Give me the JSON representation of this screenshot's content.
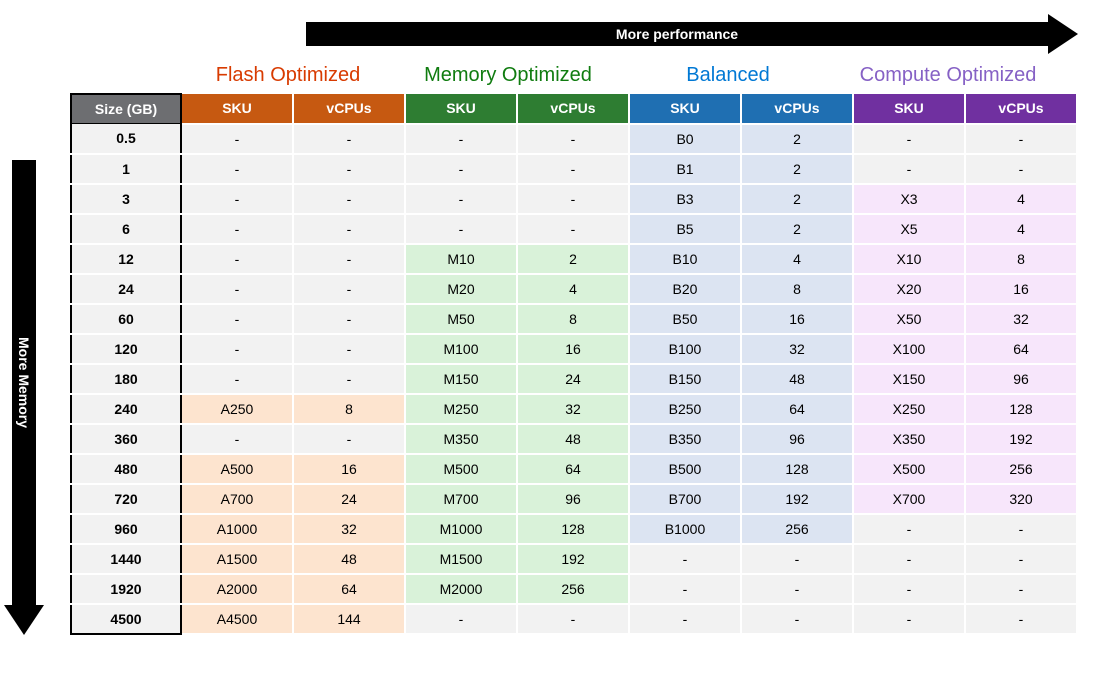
{
  "arrows": {
    "top": "More performance",
    "left": "More Memory"
  },
  "tiers": [
    {
      "key": "flash",
      "label": "Flash Optimized"
    },
    {
      "key": "memory",
      "label": "Memory Optimized"
    },
    {
      "key": "balanced",
      "label": "Balanced"
    },
    {
      "key": "compute",
      "label": "Compute Optimized"
    }
  ],
  "columns": {
    "size": "Size (GB)",
    "sku": "SKU",
    "vcpu": "vCPUs"
  },
  "dash": "-",
  "rows": [
    {
      "size": "0.5",
      "flash": {
        "sku": null,
        "vcpu": null
      },
      "memory": {
        "sku": null,
        "vcpu": null
      },
      "balanced": {
        "sku": "B0",
        "vcpu": "2"
      },
      "compute": {
        "sku": null,
        "vcpu": null
      }
    },
    {
      "size": "1",
      "flash": {
        "sku": null,
        "vcpu": null
      },
      "memory": {
        "sku": null,
        "vcpu": null
      },
      "balanced": {
        "sku": "B1",
        "vcpu": "2"
      },
      "compute": {
        "sku": null,
        "vcpu": null
      }
    },
    {
      "size": "3",
      "flash": {
        "sku": null,
        "vcpu": null
      },
      "memory": {
        "sku": null,
        "vcpu": null
      },
      "balanced": {
        "sku": "B3",
        "vcpu": "2"
      },
      "compute": {
        "sku": "X3",
        "vcpu": "4"
      }
    },
    {
      "size": "6",
      "flash": {
        "sku": null,
        "vcpu": null
      },
      "memory": {
        "sku": null,
        "vcpu": null
      },
      "balanced": {
        "sku": "B5",
        "vcpu": "2"
      },
      "compute": {
        "sku": "X5",
        "vcpu": "4"
      }
    },
    {
      "size": "12",
      "flash": {
        "sku": null,
        "vcpu": null
      },
      "memory": {
        "sku": "M10",
        "vcpu": "2"
      },
      "balanced": {
        "sku": "B10",
        "vcpu": "4"
      },
      "compute": {
        "sku": "X10",
        "vcpu": "8"
      }
    },
    {
      "size": "24",
      "flash": {
        "sku": null,
        "vcpu": null
      },
      "memory": {
        "sku": "M20",
        "vcpu": "4"
      },
      "balanced": {
        "sku": "B20",
        "vcpu": "8"
      },
      "compute": {
        "sku": "X20",
        "vcpu": "16"
      }
    },
    {
      "size": "60",
      "flash": {
        "sku": null,
        "vcpu": null
      },
      "memory": {
        "sku": "M50",
        "vcpu": "8"
      },
      "balanced": {
        "sku": "B50",
        "vcpu": "16"
      },
      "compute": {
        "sku": "X50",
        "vcpu": "32"
      }
    },
    {
      "size": "120",
      "flash": {
        "sku": null,
        "vcpu": null
      },
      "memory": {
        "sku": "M100",
        "vcpu": "16"
      },
      "balanced": {
        "sku": "B100",
        "vcpu": "32"
      },
      "compute": {
        "sku": "X100",
        "vcpu": "64"
      }
    },
    {
      "size": "180",
      "flash": {
        "sku": null,
        "vcpu": null
      },
      "memory": {
        "sku": "M150",
        "vcpu": "24"
      },
      "balanced": {
        "sku": "B150",
        "vcpu": "48"
      },
      "compute": {
        "sku": "X150",
        "vcpu": "96"
      }
    },
    {
      "size": "240",
      "flash": {
        "sku": "A250",
        "vcpu": "8"
      },
      "memory": {
        "sku": "M250",
        "vcpu": "32"
      },
      "balanced": {
        "sku": "B250",
        "vcpu": "64"
      },
      "compute": {
        "sku": "X250",
        "vcpu": "128"
      }
    },
    {
      "size": "360",
      "flash": {
        "sku": null,
        "vcpu": null
      },
      "memory": {
        "sku": "M350",
        "vcpu": "48"
      },
      "balanced": {
        "sku": "B350",
        "vcpu": "96"
      },
      "compute": {
        "sku": "X350",
        "vcpu": "192"
      }
    },
    {
      "size": "480",
      "flash": {
        "sku": "A500",
        "vcpu": "16"
      },
      "memory": {
        "sku": "M500",
        "vcpu": "64"
      },
      "balanced": {
        "sku": "B500",
        "vcpu": "128"
      },
      "compute": {
        "sku": "X500",
        "vcpu": "256"
      }
    },
    {
      "size": "720",
      "flash": {
        "sku": "A700",
        "vcpu": "24"
      },
      "memory": {
        "sku": "M700",
        "vcpu": "96"
      },
      "balanced": {
        "sku": "B700",
        "vcpu": "192"
      },
      "compute": {
        "sku": "X700",
        "vcpu": "320"
      }
    },
    {
      "size": "960",
      "flash": {
        "sku": "A1000",
        "vcpu": "32"
      },
      "memory": {
        "sku": "M1000",
        "vcpu": "128"
      },
      "balanced": {
        "sku": "B1000",
        "vcpu": "256"
      },
      "compute": {
        "sku": null,
        "vcpu": null
      }
    },
    {
      "size": "1440",
      "flash": {
        "sku": "A1500",
        "vcpu": "48"
      },
      "memory": {
        "sku": "M1500",
        "vcpu": "192"
      },
      "balanced": {
        "sku": null,
        "vcpu": null
      },
      "compute": {
        "sku": null,
        "vcpu": null
      }
    },
    {
      "size": "1920",
      "flash": {
        "sku": "A2000",
        "vcpu": "64"
      },
      "memory": {
        "sku": "M2000",
        "vcpu": "256"
      },
      "balanced": {
        "sku": null,
        "vcpu": null
      },
      "compute": {
        "sku": null,
        "vcpu": null
      }
    },
    {
      "size": "4500",
      "flash": {
        "sku": "A4500",
        "vcpu": "144"
      },
      "memory": {
        "sku": null,
        "vcpu": null
      },
      "balanced": {
        "sku": null,
        "vcpu": null
      },
      "compute": {
        "sku": null,
        "vcpu": null
      }
    }
  ],
  "chart_data": {
    "type": "table",
    "title": "SKU sizing matrix by performance tier",
    "x_axis": {
      "label": "More performance",
      "categories": [
        "Flash Optimized",
        "Memory Optimized",
        "Balanced",
        "Compute Optimized"
      ]
    },
    "y_axis": {
      "label": "More Memory",
      "values_GB": [
        0.5,
        1,
        3,
        6,
        12,
        24,
        60,
        120,
        180,
        240,
        360,
        480,
        720,
        960,
        1440,
        1920,
        4500
      ]
    },
    "series": [
      {
        "name": "Flash Optimized",
        "points": [
          {
            "size_GB": 240,
            "sku": "A250",
            "vCPUs": 8
          },
          {
            "size_GB": 480,
            "sku": "A500",
            "vCPUs": 16
          },
          {
            "size_GB": 720,
            "sku": "A700",
            "vCPUs": 24
          },
          {
            "size_GB": 960,
            "sku": "A1000",
            "vCPUs": 32
          },
          {
            "size_GB": 1440,
            "sku": "A1500",
            "vCPUs": 48
          },
          {
            "size_GB": 1920,
            "sku": "A2000",
            "vCPUs": 64
          },
          {
            "size_GB": 4500,
            "sku": "A4500",
            "vCPUs": 144
          }
        ]
      },
      {
        "name": "Memory Optimized",
        "points": [
          {
            "size_GB": 12,
            "sku": "M10",
            "vCPUs": 2
          },
          {
            "size_GB": 24,
            "sku": "M20",
            "vCPUs": 4
          },
          {
            "size_GB": 60,
            "sku": "M50",
            "vCPUs": 8
          },
          {
            "size_GB": 120,
            "sku": "M100",
            "vCPUs": 16
          },
          {
            "size_GB": 180,
            "sku": "M150",
            "vCPUs": 24
          },
          {
            "size_GB": 240,
            "sku": "M250",
            "vCPUs": 32
          },
          {
            "size_GB": 360,
            "sku": "M350",
            "vCPUs": 48
          },
          {
            "size_GB": 480,
            "sku": "M500",
            "vCPUs": 64
          },
          {
            "size_GB": 720,
            "sku": "M700",
            "vCPUs": 96
          },
          {
            "size_GB": 960,
            "sku": "M1000",
            "vCPUs": 128
          },
          {
            "size_GB": 1440,
            "sku": "M1500",
            "vCPUs": 192
          },
          {
            "size_GB": 1920,
            "sku": "M2000",
            "vCPUs": 256
          }
        ]
      },
      {
        "name": "Balanced",
        "points": [
          {
            "size_GB": 0.5,
            "sku": "B0",
            "vCPUs": 2
          },
          {
            "size_GB": 1,
            "sku": "B1",
            "vCPUs": 2
          },
          {
            "size_GB": 3,
            "sku": "B3",
            "vCPUs": 2
          },
          {
            "size_GB": 6,
            "sku": "B5",
            "vCPUs": 2
          },
          {
            "size_GB": 12,
            "sku": "B10",
            "vCPUs": 4
          },
          {
            "size_GB": 24,
            "sku": "B20",
            "vCPUs": 8
          },
          {
            "size_GB": 60,
            "sku": "B50",
            "vCPUs": 16
          },
          {
            "size_GB": 120,
            "sku": "B100",
            "vCPUs": 32
          },
          {
            "size_GB": 180,
            "sku": "B150",
            "vCPUs": 48
          },
          {
            "size_GB": 240,
            "sku": "B250",
            "vCPUs": 64
          },
          {
            "size_GB": 360,
            "sku": "B350",
            "vCPUs": 96
          },
          {
            "size_GB": 480,
            "sku": "B500",
            "vCPUs": 128
          },
          {
            "size_GB": 720,
            "sku": "B700",
            "vCPUs": 192
          },
          {
            "size_GB": 960,
            "sku": "B1000",
            "vCPUs": 256
          }
        ]
      },
      {
        "name": "Compute Optimized",
        "points": [
          {
            "size_GB": 3,
            "sku": "X3",
            "vCPUs": 4
          },
          {
            "size_GB": 6,
            "sku": "X5",
            "vCPUs": 4
          },
          {
            "size_GB": 12,
            "sku": "X10",
            "vCPUs": 8
          },
          {
            "size_GB": 24,
            "sku": "X20",
            "vCPUs": 16
          },
          {
            "size_GB": 60,
            "sku": "X50",
            "vCPUs": 32
          },
          {
            "size_GB": 120,
            "sku": "X100",
            "vCPUs": 64
          },
          {
            "size_GB": 180,
            "sku": "X150",
            "vCPUs": 96
          },
          {
            "size_GB": 240,
            "sku": "X250",
            "vCPUs": 128
          },
          {
            "size_GB": 360,
            "sku": "X350",
            "vCPUs": 192
          },
          {
            "size_GB": 480,
            "sku": "X500",
            "vCPUs": 256
          },
          {
            "size_GB": 720,
            "sku": "X700",
            "vCPUs": 320
          }
        ]
      }
    ]
  }
}
